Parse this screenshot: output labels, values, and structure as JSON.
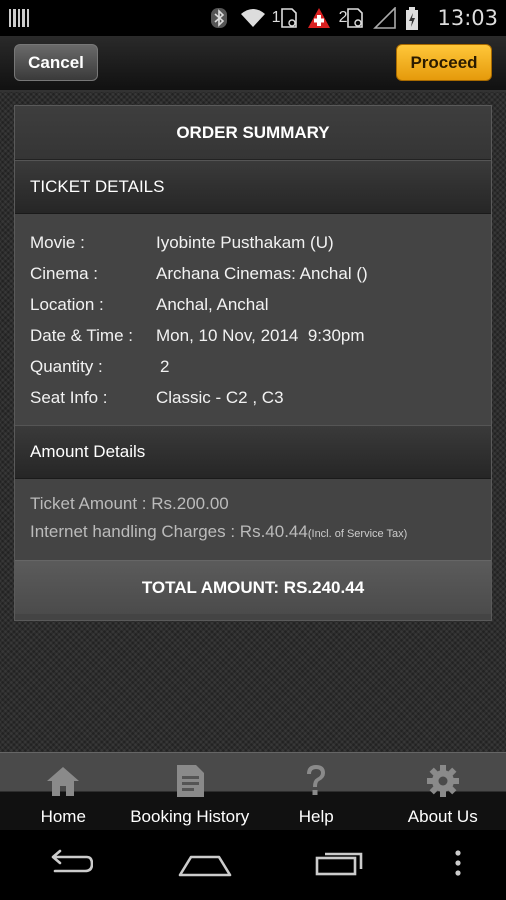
{
  "status_bar": {
    "time": "13:03",
    "sim1_label": "1",
    "sim2_label": "2"
  },
  "toolbar": {
    "cancel_label": "Cancel",
    "proceed_label": "Proceed"
  },
  "order_summary": {
    "title": "ORDER SUMMARY",
    "ticket_details_title": "TICKET DETAILS",
    "details": [
      {
        "label": "Movie :",
        "value": "Iyobinte Pusthakam (U)"
      },
      {
        "label": "Cinema :",
        "value": "Archana Cinemas: Anchal ()"
      },
      {
        "label": "Location :",
        "value": "Anchal, Anchal"
      },
      {
        "label": "Date & Time :",
        "value": "Mon, 10 Nov, 2014  9:30pm"
      },
      {
        "label": "Quantity :",
        "value": "2"
      },
      {
        "label": "Seat Info :",
        "value": "Classic - C2 , C3"
      }
    ],
    "amount_details_title": "Amount Details",
    "ticket_amount": "Ticket Amount : Rs.200.00",
    "internet_charges": "Internet handling Charges : Rs.40.44",
    "tax_note": "(Incl. of Service Tax)",
    "total": "TOTAL AMOUNT: RS.240.44"
  },
  "bottom_nav": [
    {
      "label": "Home",
      "icon": "home-icon"
    },
    {
      "label": "Booking History",
      "icon": "document-icon"
    },
    {
      "label": "Help",
      "icon": "help-icon"
    },
    {
      "label": "About Us",
      "icon": "gear-icon"
    }
  ],
  "colors": {
    "proceed": "#f5b21f",
    "background": "#2d2d2d",
    "card": "#444444"
  }
}
